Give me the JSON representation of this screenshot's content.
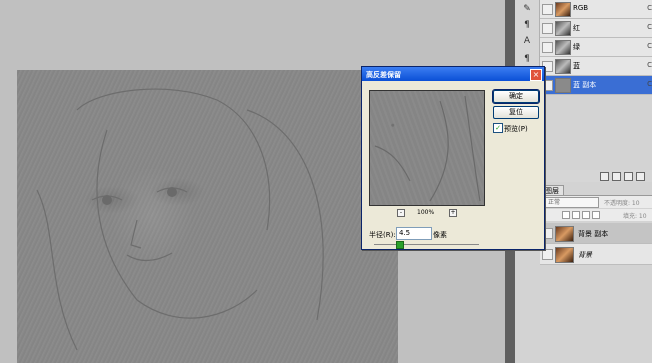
{
  "dialog": {
    "title": "高反差保留",
    "ok_label": "确定",
    "reset_label": "复位",
    "preview_label": "预览(P)",
    "preview_checked": true,
    "zoom_minus": "-",
    "zoom_plus": "+",
    "zoom_value": "100%",
    "radius_label": "半径(R):",
    "radius_value": "4.5",
    "radius_unit": "像素",
    "close_symbol": "×"
  },
  "channels": [
    {
      "label": "RGB",
      "shortcut": "C"
    },
    {
      "label": "红",
      "shortcut": "C"
    },
    {
      "label": "绿",
      "shortcut": "C"
    },
    {
      "label": "蓝",
      "shortcut": "C"
    },
    {
      "label": "蓝 副本",
      "shortcut": "C"
    }
  ],
  "layers": {
    "tab_label": "图层",
    "blend_mode": "正常",
    "opacity_label": "不透明度: 10",
    "fill_label": "填充: 10",
    "items": [
      {
        "label": "背景 副本"
      },
      {
        "label": "背景"
      }
    ]
  },
  "colors": {
    "accent": "#3a6ed4",
    "titlebar": "#0a4fd6",
    "canvas": "#878787"
  }
}
